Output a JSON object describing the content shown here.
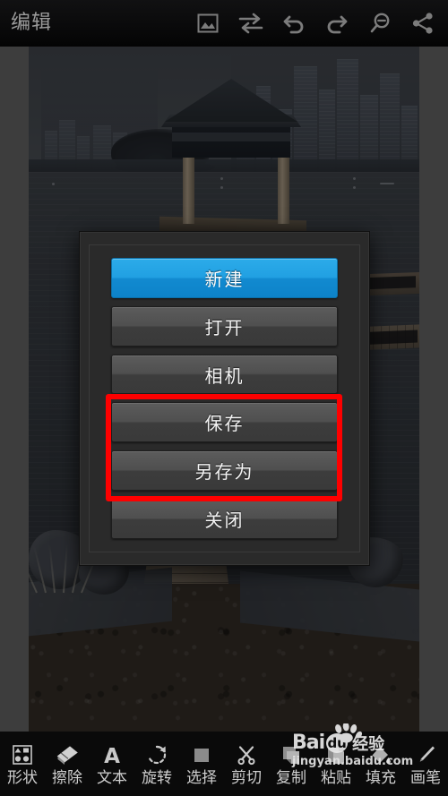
{
  "app": {
    "title": "编辑",
    "accent_blue": "#1fa0e0",
    "highlight_red": "#fe0000",
    "bar_bg": "#0a0a0a",
    "dialog_bg": "#2a2a2a"
  },
  "topbar": {
    "title": "编辑",
    "icons": [
      {
        "name": "gallery-icon",
        "label": "图库"
      },
      {
        "name": "swap-icon",
        "label": "切换"
      },
      {
        "name": "undo-icon",
        "label": "撤销"
      },
      {
        "name": "redo-icon",
        "label": "重做"
      },
      {
        "name": "zoom-out-icon",
        "label": "缩小"
      },
      {
        "name": "share-icon",
        "label": "分享"
      }
    ]
  },
  "canvas": {
    "photo_description": "湖面栈桥与凉亭照片"
  },
  "dialog": {
    "visible": true,
    "buttons": [
      {
        "label": "新建",
        "name": "new",
        "primary": true,
        "highlighted": false
      },
      {
        "label": "打开",
        "name": "open",
        "primary": false,
        "highlighted": false
      },
      {
        "label": "相机",
        "name": "camera",
        "primary": false,
        "highlighted": false
      },
      {
        "label": "保存",
        "name": "save",
        "primary": false,
        "highlighted": true
      },
      {
        "label": "另存为",
        "name": "save-as",
        "primary": false,
        "highlighted": true
      },
      {
        "label": "关闭",
        "name": "close",
        "primary": false,
        "highlighted": false
      }
    ]
  },
  "bottombar": {
    "items": [
      {
        "label": "形状",
        "icon": "shapes-icon"
      },
      {
        "label": "擦除",
        "icon": "eraser-icon"
      },
      {
        "label": "文本",
        "icon": "text-icon"
      },
      {
        "label": "旋转",
        "icon": "rotate-icon"
      },
      {
        "label": "选择",
        "icon": "select-icon"
      },
      {
        "label": "剪切",
        "icon": "scissors-icon"
      },
      {
        "label": "复制",
        "icon": "copy-icon"
      },
      {
        "label": "粘贴",
        "icon": "paste-icon"
      },
      {
        "label": "填充",
        "icon": "fill-icon"
      },
      {
        "label": "画笔",
        "icon": "brush-icon"
      }
    ]
  },
  "watermark": {
    "brand": "Bai",
    "brand_mark": "du",
    "suffix": "经验",
    "url": "jingyan.baidu.com"
  }
}
